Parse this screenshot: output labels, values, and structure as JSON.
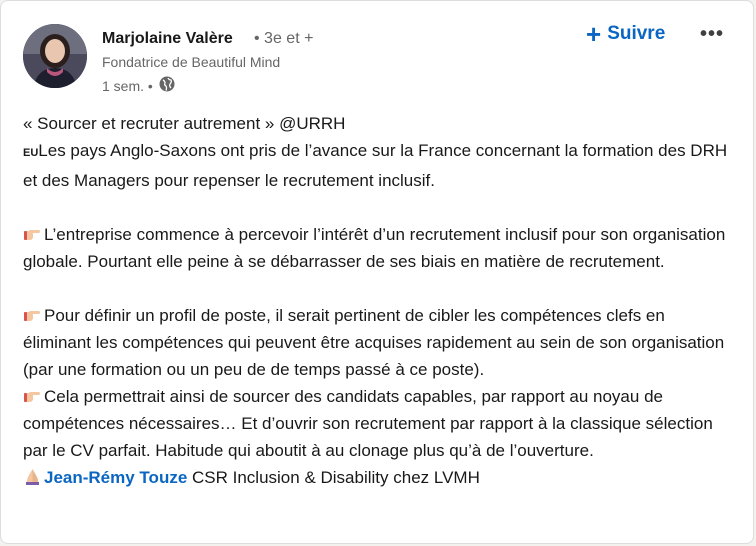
{
  "author": {
    "name": "Marjolaine Valère",
    "degree": "• 3e et +",
    "headline": "Fondatrice de Beautiful Mind",
    "time": "1 sem. •"
  },
  "actions": {
    "follow_label": "Suivre",
    "follow_plus": "+",
    "more_label": "•••"
  },
  "post": {
    "line1": "« Sourcer et recruter autrement » @URRH",
    "flag": "EU",
    "line2": "Les pays Anglo-Saxons ont pris de l’avance sur la France concernant la formation des DRH et des Managers pour repenser le recrutement inclusif.",
    "para2": "L’entreprise commence à percevoir l’intérêt d’un recrutement inclusif pour son organisation globale. Pourtant elle peine à se débarrasser de ses biais en matière de recrutement.",
    "para3": "Pour définir un profil de poste, il serait pertinent de cibler les compétences clefs en éliminant les compétences qui peuvent être acquises rapidement au sein de son organisation (par une formation ou un peu de de temps passé à ce poste).",
    "para4": "Cela permettrait ainsi de sourcer des candidats capables, par rapport au noyau de compétences nécessaires… Et d’ouvrir son recrutement par rapport à la classique sélection par le CV parfait. Habitude qui aboutit à au clonage plus qu’à de l’ouverture.",
    "mention_name": "Jean-Rémy Touze",
    "mention_rest": " CSR Inclusion & Disability chez LVMH"
  },
  "icons": {
    "pointing": "backhand-index-pointing-right-icon",
    "hands": "folded-hands-icon",
    "globe": "globe-icon"
  }
}
